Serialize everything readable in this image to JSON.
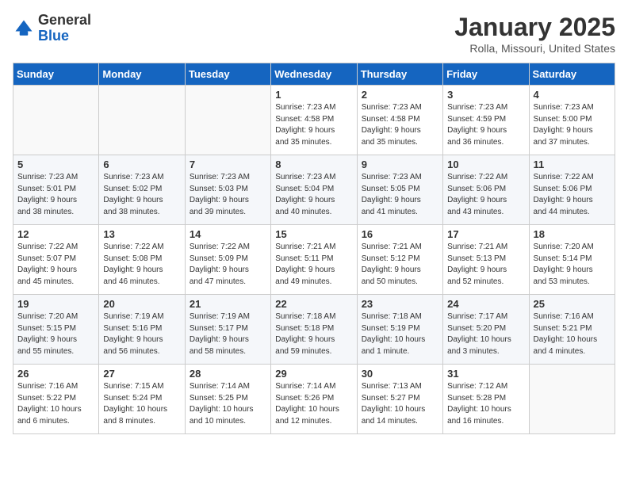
{
  "header": {
    "logo_general": "General",
    "logo_blue": "Blue",
    "title": "January 2025",
    "subtitle": "Rolla, Missouri, United States"
  },
  "weekdays": [
    "Sunday",
    "Monday",
    "Tuesday",
    "Wednesday",
    "Thursday",
    "Friday",
    "Saturday"
  ],
  "weeks": [
    [
      {
        "day": "",
        "info": ""
      },
      {
        "day": "",
        "info": ""
      },
      {
        "day": "",
        "info": ""
      },
      {
        "day": "1",
        "info": "Sunrise: 7:23 AM\nSunset: 4:58 PM\nDaylight: 9 hours\nand 35 minutes."
      },
      {
        "day": "2",
        "info": "Sunrise: 7:23 AM\nSunset: 4:58 PM\nDaylight: 9 hours\nand 35 minutes."
      },
      {
        "day": "3",
        "info": "Sunrise: 7:23 AM\nSunset: 4:59 PM\nDaylight: 9 hours\nand 36 minutes."
      },
      {
        "day": "4",
        "info": "Sunrise: 7:23 AM\nSunset: 5:00 PM\nDaylight: 9 hours\nand 37 minutes."
      }
    ],
    [
      {
        "day": "5",
        "info": "Sunrise: 7:23 AM\nSunset: 5:01 PM\nDaylight: 9 hours\nand 38 minutes."
      },
      {
        "day": "6",
        "info": "Sunrise: 7:23 AM\nSunset: 5:02 PM\nDaylight: 9 hours\nand 38 minutes."
      },
      {
        "day": "7",
        "info": "Sunrise: 7:23 AM\nSunset: 5:03 PM\nDaylight: 9 hours\nand 39 minutes."
      },
      {
        "day": "8",
        "info": "Sunrise: 7:23 AM\nSunset: 5:04 PM\nDaylight: 9 hours\nand 40 minutes."
      },
      {
        "day": "9",
        "info": "Sunrise: 7:23 AM\nSunset: 5:05 PM\nDaylight: 9 hours\nand 41 minutes."
      },
      {
        "day": "10",
        "info": "Sunrise: 7:22 AM\nSunset: 5:06 PM\nDaylight: 9 hours\nand 43 minutes."
      },
      {
        "day": "11",
        "info": "Sunrise: 7:22 AM\nSunset: 5:06 PM\nDaylight: 9 hours\nand 44 minutes."
      }
    ],
    [
      {
        "day": "12",
        "info": "Sunrise: 7:22 AM\nSunset: 5:07 PM\nDaylight: 9 hours\nand 45 minutes."
      },
      {
        "day": "13",
        "info": "Sunrise: 7:22 AM\nSunset: 5:08 PM\nDaylight: 9 hours\nand 46 minutes."
      },
      {
        "day": "14",
        "info": "Sunrise: 7:22 AM\nSunset: 5:09 PM\nDaylight: 9 hours\nand 47 minutes."
      },
      {
        "day": "15",
        "info": "Sunrise: 7:21 AM\nSunset: 5:11 PM\nDaylight: 9 hours\nand 49 minutes."
      },
      {
        "day": "16",
        "info": "Sunrise: 7:21 AM\nSunset: 5:12 PM\nDaylight: 9 hours\nand 50 minutes."
      },
      {
        "day": "17",
        "info": "Sunrise: 7:21 AM\nSunset: 5:13 PM\nDaylight: 9 hours\nand 52 minutes."
      },
      {
        "day": "18",
        "info": "Sunrise: 7:20 AM\nSunset: 5:14 PM\nDaylight: 9 hours\nand 53 minutes."
      }
    ],
    [
      {
        "day": "19",
        "info": "Sunrise: 7:20 AM\nSunset: 5:15 PM\nDaylight: 9 hours\nand 55 minutes."
      },
      {
        "day": "20",
        "info": "Sunrise: 7:19 AM\nSunset: 5:16 PM\nDaylight: 9 hours\nand 56 minutes."
      },
      {
        "day": "21",
        "info": "Sunrise: 7:19 AM\nSunset: 5:17 PM\nDaylight: 9 hours\nand 58 minutes."
      },
      {
        "day": "22",
        "info": "Sunrise: 7:18 AM\nSunset: 5:18 PM\nDaylight: 9 hours\nand 59 minutes."
      },
      {
        "day": "23",
        "info": "Sunrise: 7:18 AM\nSunset: 5:19 PM\nDaylight: 10 hours\nand 1 minute."
      },
      {
        "day": "24",
        "info": "Sunrise: 7:17 AM\nSunset: 5:20 PM\nDaylight: 10 hours\nand 3 minutes."
      },
      {
        "day": "25",
        "info": "Sunrise: 7:16 AM\nSunset: 5:21 PM\nDaylight: 10 hours\nand 4 minutes."
      }
    ],
    [
      {
        "day": "26",
        "info": "Sunrise: 7:16 AM\nSunset: 5:22 PM\nDaylight: 10 hours\nand 6 minutes."
      },
      {
        "day": "27",
        "info": "Sunrise: 7:15 AM\nSunset: 5:24 PM\nDaylight: 10 hours\nand 8 minutes."
      },
      {
        "day": "28",
        "info": "Sunrise: 7:14 AM\nSunset: 5:25 PM\nDaylight: 10 hours\nand 10 minutes."
      },
      {
        "day": "29",
        "info": "Sunrise: 7:14 AM\nSunset: 5:26 PM\nDaylight: 10 hours\nand 12 minutes."
      },
      {
        "day": "30",
        "info": "Sunrise: 7:13 AM\nSunset: 5:27 PM\nDaylight: 10 hours\nand 14 minutes."
      },
      {
        "day": "31",
        "info": "Sunrise: 7:12 AM\nSunset: 5:28 PM\nDaylight: 10 hours\nand 16 minutes."
      },
      {
        "day": "",
        "info": ""
      }
    ]
  ]
}
